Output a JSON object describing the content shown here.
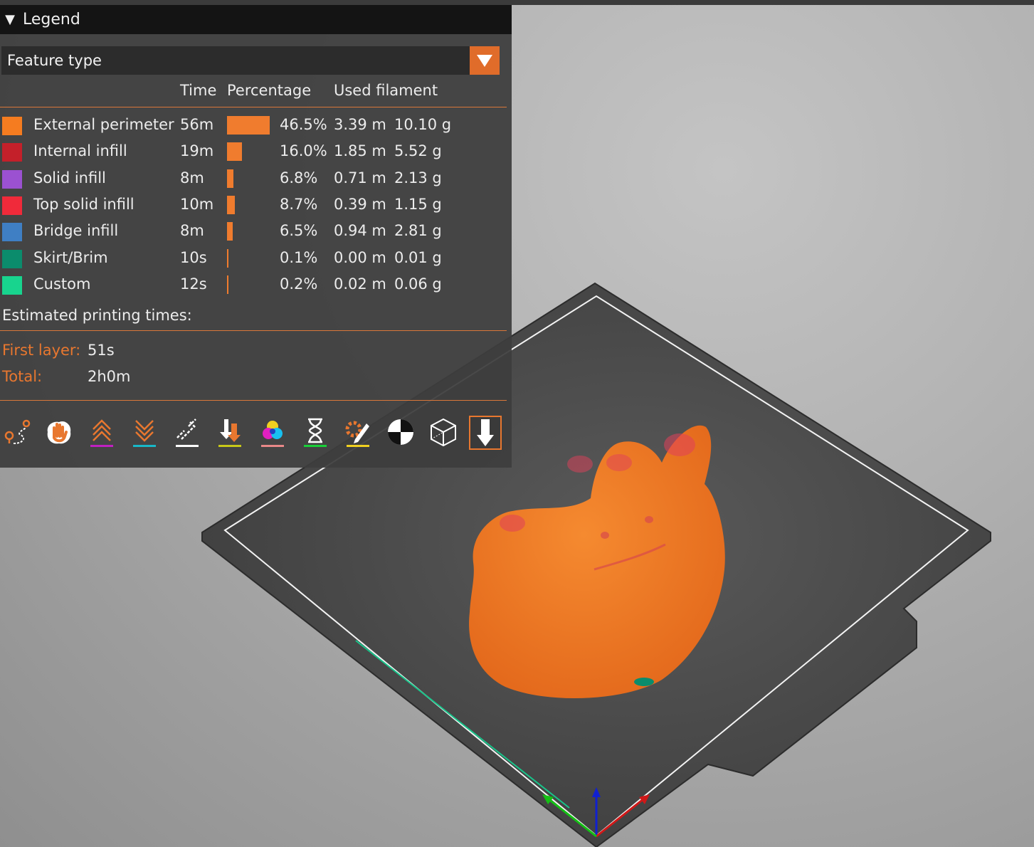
{
  "legend": {
    "title": "Legend",
    "view_type": "Feature type",
    "columns": {
      "time": "Time",
      "percentage": "Percentage",
      "used_filament": "Used filament"
    },
    "rows": [
      {
        "name": "External perimeter",
        "time": "56m",
        "percentage": "46.5%",
        "length": "3.39 m",
        "weight": "10.10 g",
        "color": "#f57c20",
        "pct": 46.5
      },
      {
        "name": "Internal infill",
        "time": "19m",
        "percentage": "16.0%",
        "length": "1.85 m",
        "weight": "5.52 g",
        "color": "#c4202a",
        "pct": 16.0
      },
      {
        "name": "Solid infill",
        "time": "8m",
        "percentage": "6.8%",
        "length": "0.71 m",
        "weight": "2.13 g",
        "color": "#9b51d1",
        "pct": 6.8
      },
      {
        "name": "Top solid infill",
        "time": "10m",
        "percentage": "8.7%",
        "length": "0.39 m",
        "weight": "1.15 g",
        "color": "#f02a3a",
        "pct": 8.7
      },
      {
        "name": "Bridge infill",
        "time": "8m",
        "percentage": "6.5%",
        "length": "0.94 m",
        "weight": "2.81 g",
        "color": "#3f7fc4",
        "pct": 6.5
      },
      {
        "name": "Skirt/Brim",
        "time": "10s",
        "percentage": "0.1%",
        "length": "0.00 m",
        "weight": "0.01 g",
        "color": "#0b8c6c",
        "pct": 0.1
      },
      {
        "name": "Custom",
        "time": "12s",
        "percentage": "0.2%",
        "length": "0.02 m",
        "weight": "0.06 g",
        "color": "#18d48e",
        "pct": 0.2
      }
    ],
    "estimated_title": "Estimated printing times:",
    "first_layer_label": "First layer:",
    "first_layer_value": "51s",
    "total_label": "Total:",
    "total_value": "2h0m"
  },
  "toolbar": {
    "icons": [
      "travel-icon",
      "wipe-hand-icon",
      "retractions-icon",
      "deretractions-icon",
      "seams-icon",
      "tool-changes-icon",
      "color-changes-icon",
      "pause-prints-icon",
      "custom-gcode-icon",
      "center-of-gravity-icon",
      "shells-icon",
      "tool-marker-icon"
    ],
    "active": "tool-marker-icon"
  },
  "colors": {
    "accent": "#e8772f",
    "panel": "#3e3e3e",
    "model": "#f07a22"
  }
}
